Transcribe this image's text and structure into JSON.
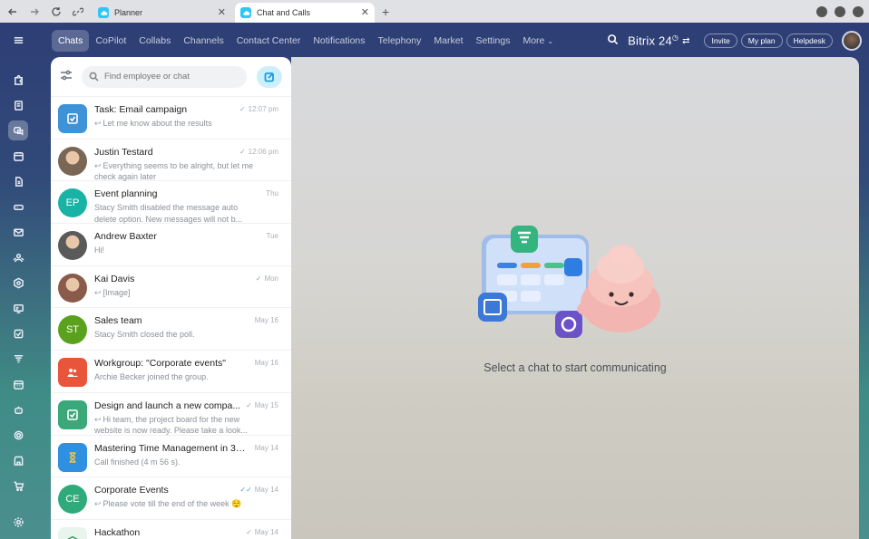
{
  "browser": {
    "tabs": [
      {
        "label": "Planner",
        "active": false
      },
      {
        "label": "Chat and Calls",
        "active": true
      }
    ]
  },
  "topnav": {
    "items": [
      "Chats",
      "CoPilot",
      "Collabs",
      "Channels",
      "Contact Center",
      "Notifications",
      "Telephony",
      "Market",
      "Settings",
      "More"
    ],
    "active": "Chats"
  },
  "header": {
    "brand": "Bitrix 24",
    "invite": "Invite",
    "plan": "My plan",
    "helpdesk": "Helpdesk"
  },
  "search": {
    "placeholder": "Find employee or chat"
  },
  "chats": [
    {
      "name": "Task: Email campaign",
      "time": "12:07 pm",
      "check": "single",
      "message": "Let me know about the results",
      "reply": true,
      "avatar": {
        "type": "task-icon",
        "color": "#3d93d5"
      }
    },
    {
      "name": "Justin Testard",
      "time": "12:06 pm",
      "check": "single",
      "message": "Everything seems to be alright, but let me check again later",
      "reply": true,
      "avatar": {
        "type": "photo",
        "color": "#7a6654"
      }
    },
    {
      "name": "Event planning",
      "time": "Thu",
      "check": "none",
      "message": "Stacy Smith disabled the message auto delete option. New messages will not b...",
      "reply": false,
      "avatar": {
        "type": "initials",
        "initials": "EP",
        "color": "#19b3a5"
      }
    },
    {
      "name": "Andrew Baxter",
      "time": "Tue",
      "check": "none",
      "message": "Hi!",
      "reply": false,
      "avatar": {
        "type": "photo",
        "color": "#5a5a5a"
      }
    },
    {
      "name": "Kai Davis",
      "time": "Mon",
      "check": "single",
      "message": "[Image]",
      "reply": true,
      "avatar": {
        "type": "photo",
        "color": "#8a5a4a"
      }
    },
    {
      "name": "Sales team",
      "time": "May 16",
      "check": "none",
      "message": "Stacy Smith closed the poll.",
      "reply": false,
      "avatar": {
        "type": "initials",
        "initials": "ST",
        "color": "#5aa21e"
      }
    },
    {
      "name": "Workgroup: \"Corporate events\"",
      "time": "May 16",
      "check": "none",
      "message": "Archie Becker joined the group.",
      "reply": false,
      "avatar": {
        "type": "group-icon",
        "color": "#e8553a"
      }
    },
    {
      "name": "Design and launch a new compa...",
      "time": "May 15",
      "check": "single",
      "message": "Hi team, the project board for the new website is now ready. Please take a look...",
      "reply": true,
      "avatar": {
        "type": "task-icon",
        "color": "#3ba87a"
      }
    },
    {
      "name": "Mastering Time Management in 30...",
      "time": "May 14",
      "check": "none",
      "message": "Call finished (4 m 56 s).",
      "reply": false,
      "avatar": {
        "type": "hourglass-icon",
        "color": "#2f8fe0"
      }
    },
    {
      "name": "Corporate Events",
      "time": "May 14",
      "check": "double",
      "message": "Please vote till the end of the week 😌",
      "reply": true,
      "muted": true,
      "avatar": {
        "type": "initials",
        "initials": "CE",
        "color": "#2faa7a"
      }
    },
    {
      "name": "Hackathon",
      "time": "May 14",
      "check": "single",
      "message": "",
      "reply": false,
      "avatar": {
        "type": "badge-icon",
        "color": "#e9f5ec"
      }
    }
  ],
  "empty_state": {
    "text": "Select a chat to start communicating"
  }
}
